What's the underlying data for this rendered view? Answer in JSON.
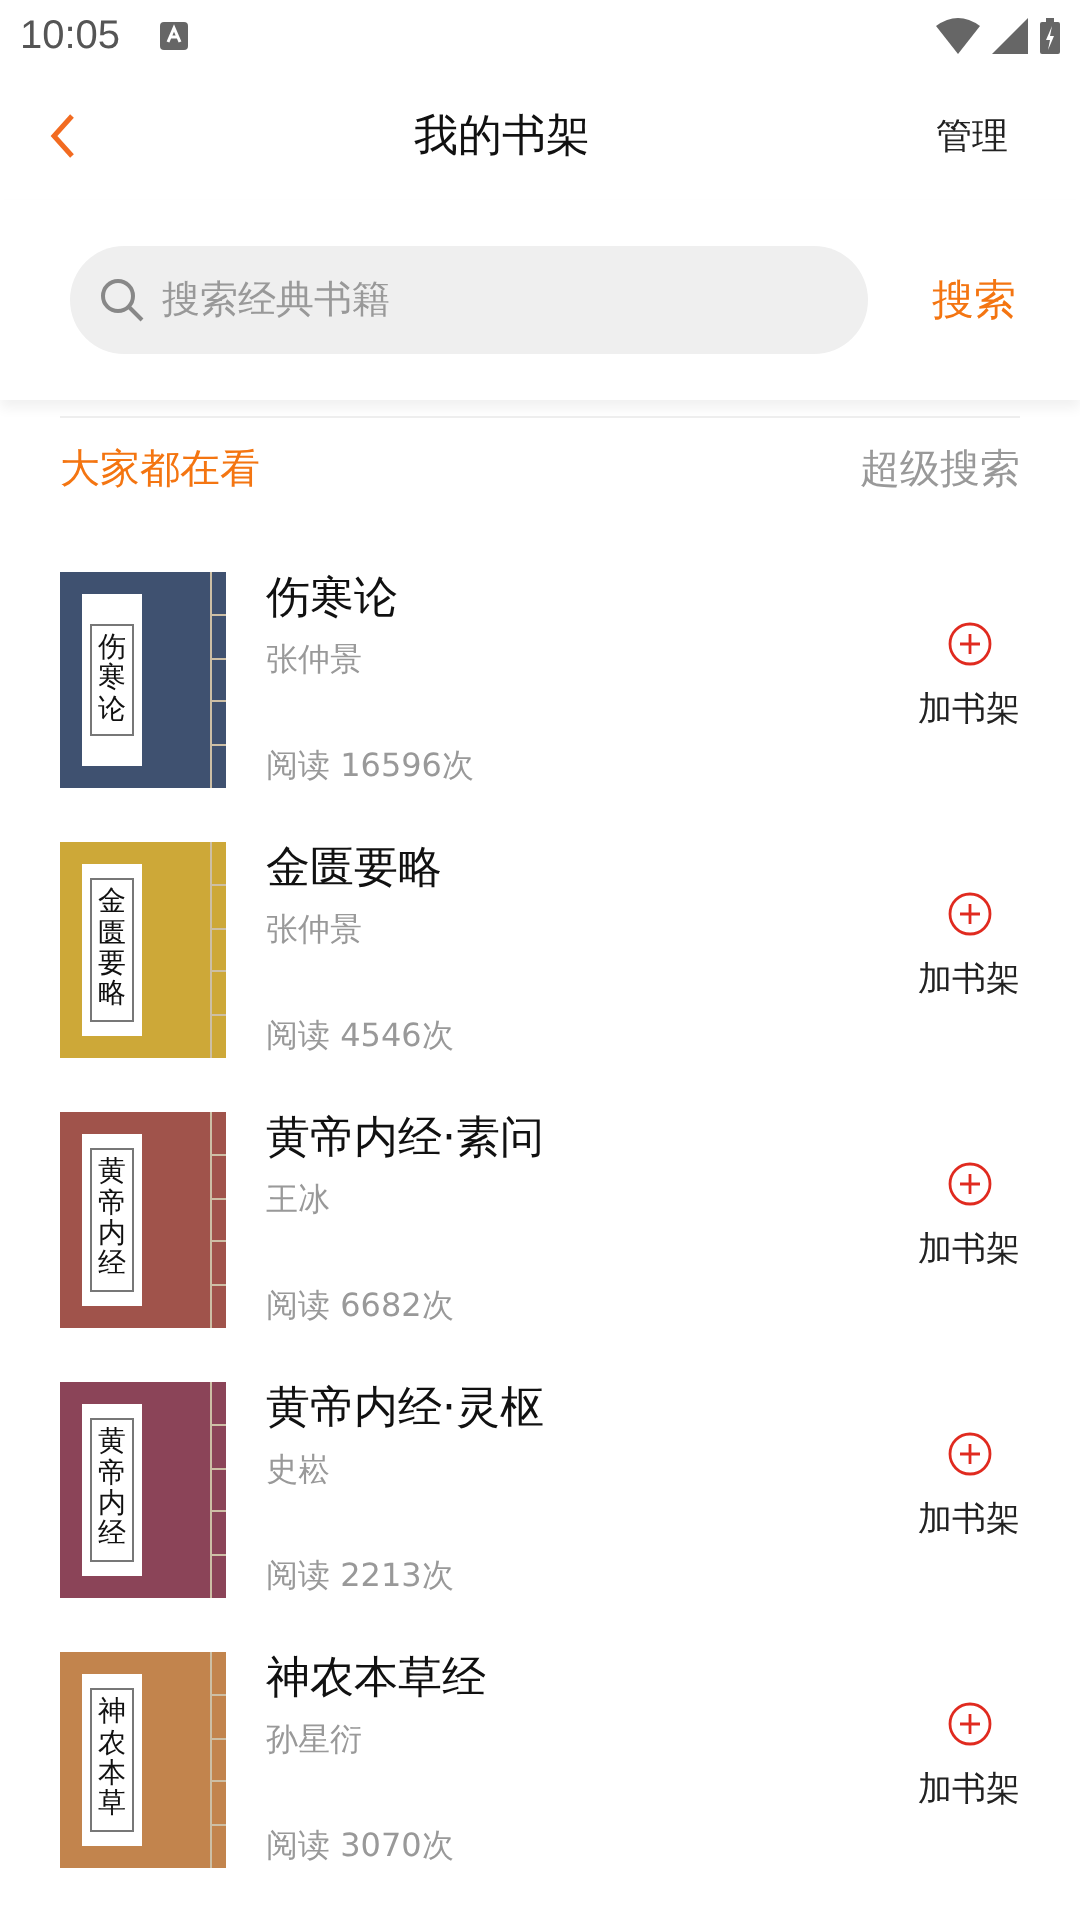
{
  "status_bar": {
    "time": "10:05"
  },
  "header": {
    "title": "我的书架",
    "action": "管理"
  },
  "search": {
    "placeholder": "搜索经典书籍",
    "button": "搜索"
  },
  "section": {
    "title": "大家都在看",
    "link": "超级搜索"
  },
  "books": [
    {
      "cover_title": "伤寒论",
      "color": "#3f5170",
      "title": "伤寒论",
      "author": "张仲景",
      "reads": "阅读 16596次",
      "add_label": "加书架"
    },
    {
      "cover_title": "金匮要略",
      "color": "#cda838",
      "title": "金匮要略",
      "author": "张仲景",
      "reads": "阅读 4546次",
      "add_label": "加书架"
    },
    {
      "cover_title": "黄帝内经",
      "color": "#a0534b",
      "title": "黄帝内经·素问",
      "author": "王冰",
      "reads": "阅读 6682次",
      "add_label": "加书架"
    },
    {
      "cover_title": "黄帝内经",
      "color": "#8b4458",
      "title": "黄帝内经·灵枢",
      "author": "史崧",
      "reads": "阅读 2213次",
      "add_label": "加书架"
    },
    {
      "cover_title": "神农本草",
      "color": "#c2844d",
      "title": "神农本草经",
      "author": "孙星衍",
      "reads": "阅读 3070次",
      "add_label": "加书架"
    }
  ]
}
